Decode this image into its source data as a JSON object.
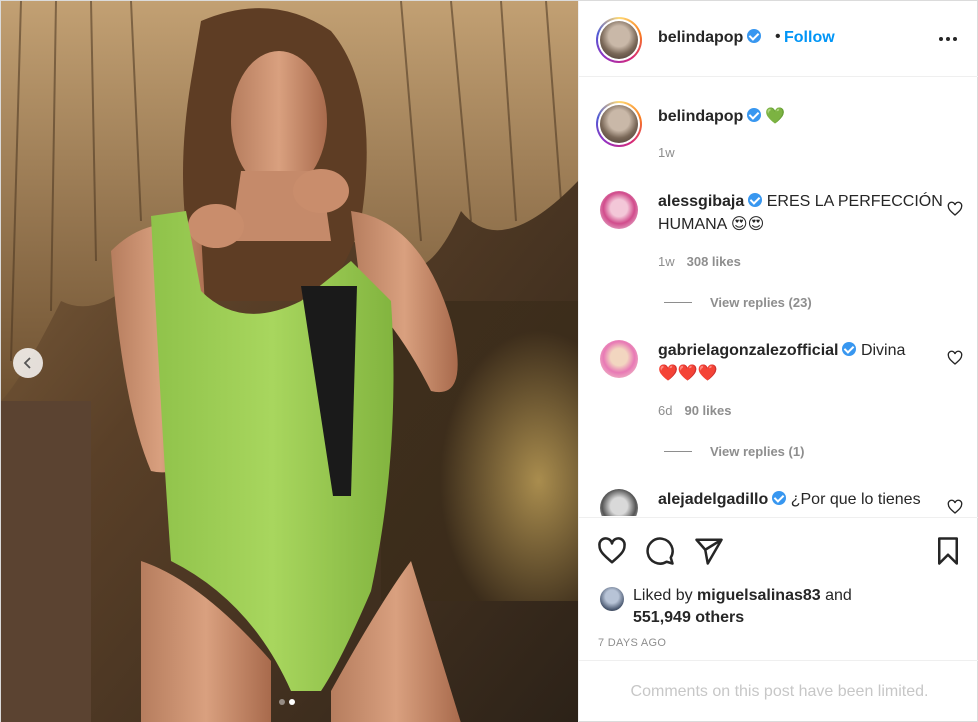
{
  "post": {
    "username": "belindapop",
    "follow_label": "Follow",
    "bullet": "•",
    "carousel": {
      "current_index": 2,
      "total": 2
    }
  },
  "caption": {
    "username": "belindapop",
    "text": "💚",
    "time": "1w"
  },
  "comments": [
    {
      "username": "alessgibaja",
      "verified": true,
      "line1": "ERES LA PERFECCIÓN",
      "line2": "HUMANA 😍😍",
      "time": "1w",
      "likes": "308 likes",
      "replies": "View replies (23)"
    },
    {
      "username": "gabrielagonzalezofficial",
      "verified": true,
      "line1": "Divina",
      "line2": "❤️❤️❤️",
      "time": "6d",
      "likes": "90 likes",
      "replies": "View replies (1)"
    },
    {
      "username": "alejadelgadillo",
      "verified": true,
      "line1": "¿Por que lo tienes"
    }
  ],
  "engagement": {
    "liked_by_prefix": "Liked by",
    "liked_by_user": "miguelsalinas83",
    "and": "and",
    "others": "551,949 others",
    "posted": "7 DAYS AGO"
  },
  "footer": {
    "limited_notice": "Comments on this post have been limited."
  },
  "icons": {
    "more": "more-options-icon",
    "prev": "chevron-left-icon",
    "like": "heart-icon",
    "comment": "comment-icon",
    "share": "share-icon",
    "save": "bookmark-icon",
    "verified": "verified-badge-icon"
  },
  "colors": {
    "link_blue": "#0095f6",
    "verified_blue": "#3897f0",
    "secondary_text": "#8e8e8e",
    "swimsuit_green": "#9ccc52"
  }
}
